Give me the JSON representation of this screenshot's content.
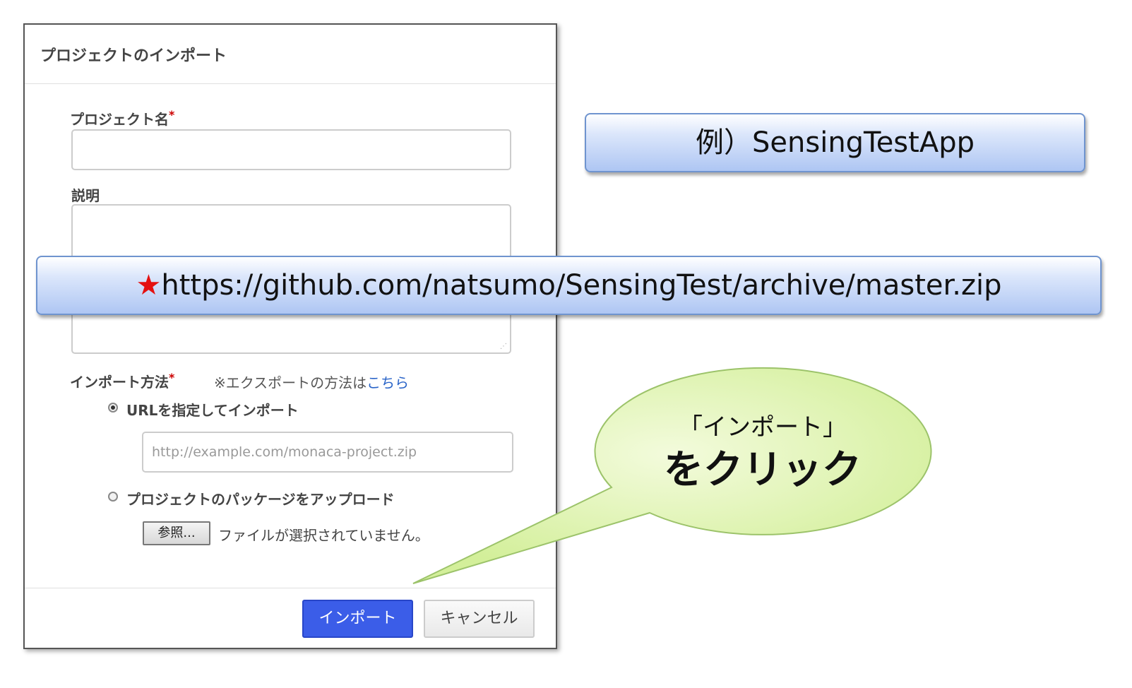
{
  "dialog": {
    "title": "プロジェクトのインポート",
    "project_name_label": "プロジェクト名",
    "required_mark": "*",
    "description_label": "説明",
    "import_method_label": "インポート方法",
    "export_note": "※エクスポートの方法は",
    "export_link": "こちら",
    "radio_url_label": "URLを指定してインポート",
    "url_placeholder": "http://example.com/monaca-project.zip",
    "radio_upload_label": "プロジェクトのパッケージをアップロード",
    "browse_button": "参照...",
    "no_file_text": "ファイルが選択されていません。",
    "import_button": "インポート",
    "cancel_button": "キャンセル"
  },
  "annotations": {
    "example_name": "例）SensingTestApp",
    "url_star": "★",
    "url_text": "https://github.com/natsumo/SensingTest/archive/master.zip",
    "bubble_line1": "「インポート」",
    "bubble_line2": "をクリック"
  },
  "colors": {
    "import_button_bg": "#3b5de8",
    "callout_border": "#6f94cf",
    "bubble_fill": "#e2f6b8",
    "star": "#e41010"
  }
}
